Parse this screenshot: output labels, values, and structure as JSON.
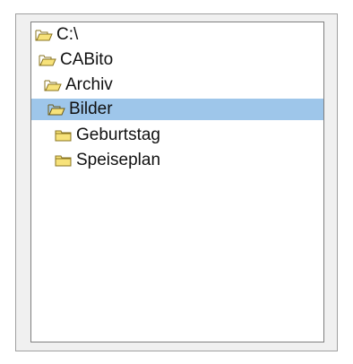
{
  "tree": {
    "items": [
      {
        "label": "C:\\",
        "icon": "open-folder-icon",
        "state": "expanded"
      },
      {
        "label": "CABito",
        "icon": "open-folder-icon",
        "state": "expanded"
      },
      {
        "label": "Archiv",
        "icon": "open-folder-icon",
        "state": "expanded"
      },
      {
        "label": "Bilder",
        "icon": "open-folder-icon",
        "state": "expanded-selected"
      },
      {
        "label": "Geburtstag",
        "icon": "folder-icon",
        "state": "collapsed"
      },
      {
        "label": "Speiseplan",
        "icon": "folder-icon",
        "state": "collapsed"
      }
    ]
  },
  "colors": {
    "selection": "#9ec6ea",
    "folder_fill": "#f7e27a",
    "folder_outline": "#8a7420"
  }
}
